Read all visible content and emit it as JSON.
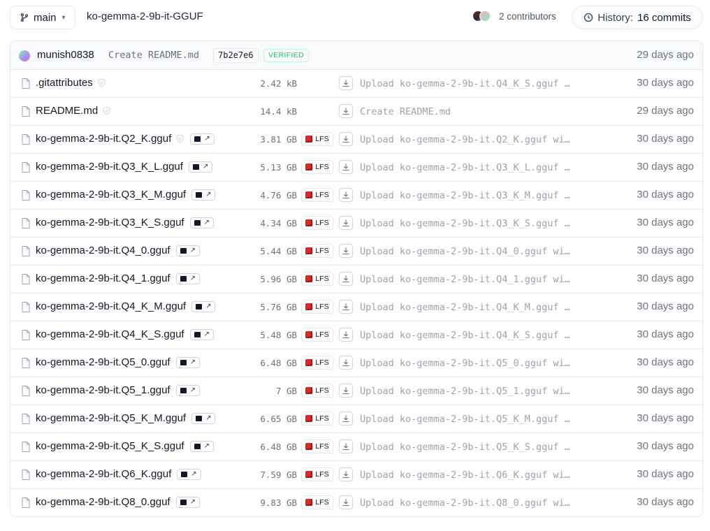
{
  "header": {
    "branch": "main",
    "repo_path": "ko-gemma-2-9b-it-GGUF",
    "contributors_label": "2 contributors",
    "history_label": "History:",
    "history_commits": "16 commits"
  },
  "last_commit": {
    "user": "munish0838",
    "message": "Create README.md",
    "sha": "7b2e7e6",
    "verified_label": "VERIFIED",
    "date": "29 days ago"
  },
  "files": [
    {
      "name": ".gitattributes",
      "size": "2.42 kB",
      "lfs": false,
      "gguf": false,
      "message": "Upload ko-gemma-2-9b-it.Q4_K_S.gguf …",
      "date": "30 days ago"
    },
    {
      "name": "README.md",
      "size": "14.4 kB",
      "lfs": false,
      "gguf": false,
      "message": "Create README.md",
      "date": "29 days ago"
    },
    {
      "name": "ko-gemma-2-9b-it.Q2_K.gguf",
      "size": "3.81 GB",
      "lfs": true,
      "gguf": true,
      "safe": true,
      "message": "Upload ko-gemma-2-9b-it.Q2_K.gguf wi…",
      "date": "30 days ago"
    },
    {
      "name": "ko-gemma-2-9b-it.Q3_K_L.gguf",
      "size": "5.13 GB",
      "lfs": true,
      "gguf": true,
      "message": "Upload ko-gemma-2-9b-it.Q3_K_L.gguf …",
      "date": "30 days ago"
    },
    {
      "name": "ko-gemma-2-9b-it.Q3_K_M.gguf",
      "size": "4.76 GB",
      "lfs": true,
      "gguf": true,
      "message": "Upload ko-gemma-2-9b-it.Q3_K_M.gguf …",
      "date": "30 days ago"
    },
    {
      "name": "ko-gemma-2-9b-it.Q3_K_S.gguf",
      "size": "4.34 GB",
      "lfs": true,
      "gguf": true,
      "message": "Upload ko-gemma-2-9b-it.Q3_K_S.gguf …",
      "date": "30 days ago"
    },
    {
      "name": "ko-gemma-2-9b-it.Q4_0.gguf",
      "size": "5.44 GB",
      "lfs": true,
      "gguf": true,
      "message": "Upload ko-gemma-2-9b-it.Q4_0.gguf wi…",
      "date": "30 days ago"
    },
    {
      "name": "ko-gemma-2-9b-it.Q4_1.gguf",
      "size": "5.96 GB",
      "lfs": true,
      "gguf": true,
      "message": "Upload ko-gemma-2-9b-it.Q4_1.gguf wi…",
      "date": "30 days ago"
    },
    {
      "name": "ko-gemma-2-9b-it.Q4_K_M.gguf",
      "size": "5.76 GB",
      "lfs": true,
      "gguf": true,
      "message": "Upload ko-gemma-2-9b-it.Q4_K_M.gguf …",
      "date": "30 days ago"
    },
    {
      "name": "ko-gemma-2-9b-it.Q4_K_S.gguf",
      "size": "5.48 GB",
      "lfs": true,
      "gguf": true,
      "message": "Upload ko-gemma-2-9b-it.Q4_K_S.gguf …",
      "date": "30 days ago"
    },
    {
      "name": "ko-gemma-2-9b-it.Q5_0.gguf",
      "size": "6.48 GB",
      "lfs": true,
      "gguf": true,
      "message": "Upload ko-gemma-2-9b-it.Q5_0.gguf wi…",
      "date": "30 days ago"
    },
    {
      "name": "ko-gemma-2-9b-it.Q5_1.gguf",
      "size": "7 GB",
      "lfs": true,
      "gguf": true,
      "message": "Upload ko-gemma-2-9b-it.Q5_1.gguf wi…",
      "date": "30 days ago"
    },
    {
      "name": "ko-gemma-2-9b-it.Q5_K_M.gguf",
      "size": "6.65 GB",
      "lfs": true,
      "gguf": true,
      "message": "Upload ko-gemma-2-9b-it.Q5_K_M.gguf …",
      "date": "30 days ago"
    },
    {
      "name": "ko-gemma-2-9b-it.Q5_K_S.gguf",
      "size": "6.48 GB",
      "lfs": true,
      "gguf": true,
      "message": "Upload ko-gemma-2-9b-it.Q5_K_S.gguf …",
      "date": "30 days ago"
    },
    {
      "name": "ko-gemma-2-9b-it.Q6_K.gguf",
      "size": "7.59 GB",
      "lfs": true,
      "gguf": true,
      "message": "Upload ko-gemma-2-9b-it.Q6_K.gguf wi…",
      "date": "30 days ago"
    },
    {
      "name": "ko-gemma-2-9b-it.Q8_0.gguf",
      "size": "9.83 GB",
      "lfs": true,
      "gguf": true,
      "message": "Upload ko-gemma-2-9b-it.Q8_0.gguf wi…",
      "date": "30 days ago"
    }
  ],
  "lfs_label": "LFS",
  "icons": {
    "branch": "git-branch-icon",
    "history": "clock-icon",
    "file": "file-icon",
    "download": "download-icon",
    "lfs": "lfs-icon",
    "safe": "shield-check-icon",
    "gguf": "gguf-viewer-icon"
  },
  "colors": {
    "verified": "#22c55e",
    "lfs_icon": "#dc2626",
    "border": "#e5e7eb",
    "muted_text": "#6b7280"
  }
}
